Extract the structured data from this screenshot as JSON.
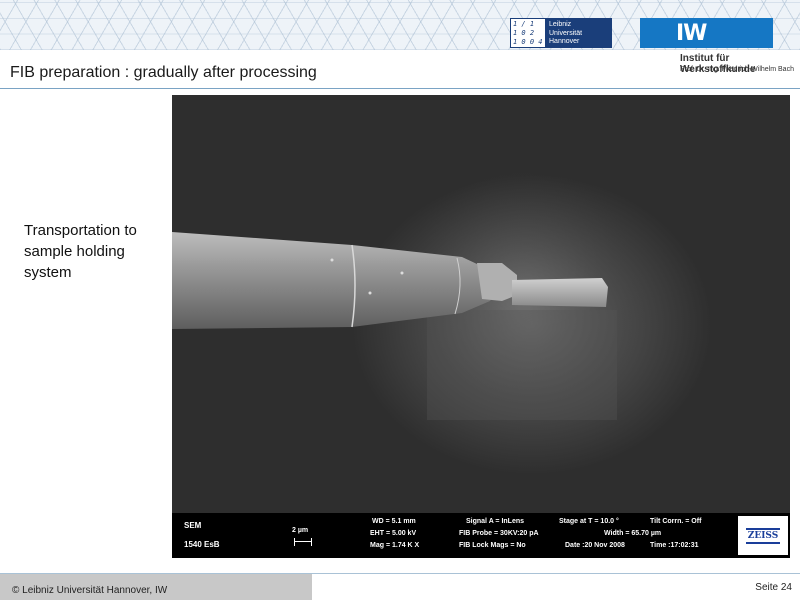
{
  "header": {
    "luh_logo_mark_lines": [
      "1 / 1",
      "1 0 2",
      "1 0 0 4"
    ],
    "luh_logo_text_lines": [
      "Leibniz",
      "Universität",
      "Hannover"
    ],
    "iw_logo_text": "IW",
    "iw_institute_name": "Institut für Werkstoffkunde",
    "iw_institute_sub": "Prof. Dr.-Ing. Friedrich-Wilhelm  Bach"
  },
  "slide": {
    "title": "FIB preparation : gradually after processing",
    "caption": "Transportation to sample holding system"
  },
  "sem_info": {
    "detector": "SEM",
    "sample_id": "1540 EsB",
    "scale_label": "2 µm",
    "wd": "WD =  5.1 mm",
    "eht": "EHT =  5.00 kV",
    "mag": "Mag =   1.74 K X",
    "signal_a": "Signal A = InLens",
    "fib_probe": "FIB Probe = 30KV:20 pA",
    "fib_lock": "FIB Lock Mags = No",
    "stage": "Stage at T =  10.0 °",
    "width": "Width = 65.70 µm",
    "date": "Date :20 Nov 2008",
    "tilt": "Tilt Corrn. = Off",
    "time": "Time :17:02:31",
    "brand": "ZEISS"
  },
  "footer": {
    "left": "© Leibniz Universität Hannover, IW",
    "right": "Seite 24"
  },
  "colors": {
    "luh_blue": "#1a3e7a",
    "iw_blue": "#1577c4",
    "zeiss_blue": "#1a3e9a",
    "footer_grey": "#c8c8c8"
  }
}
